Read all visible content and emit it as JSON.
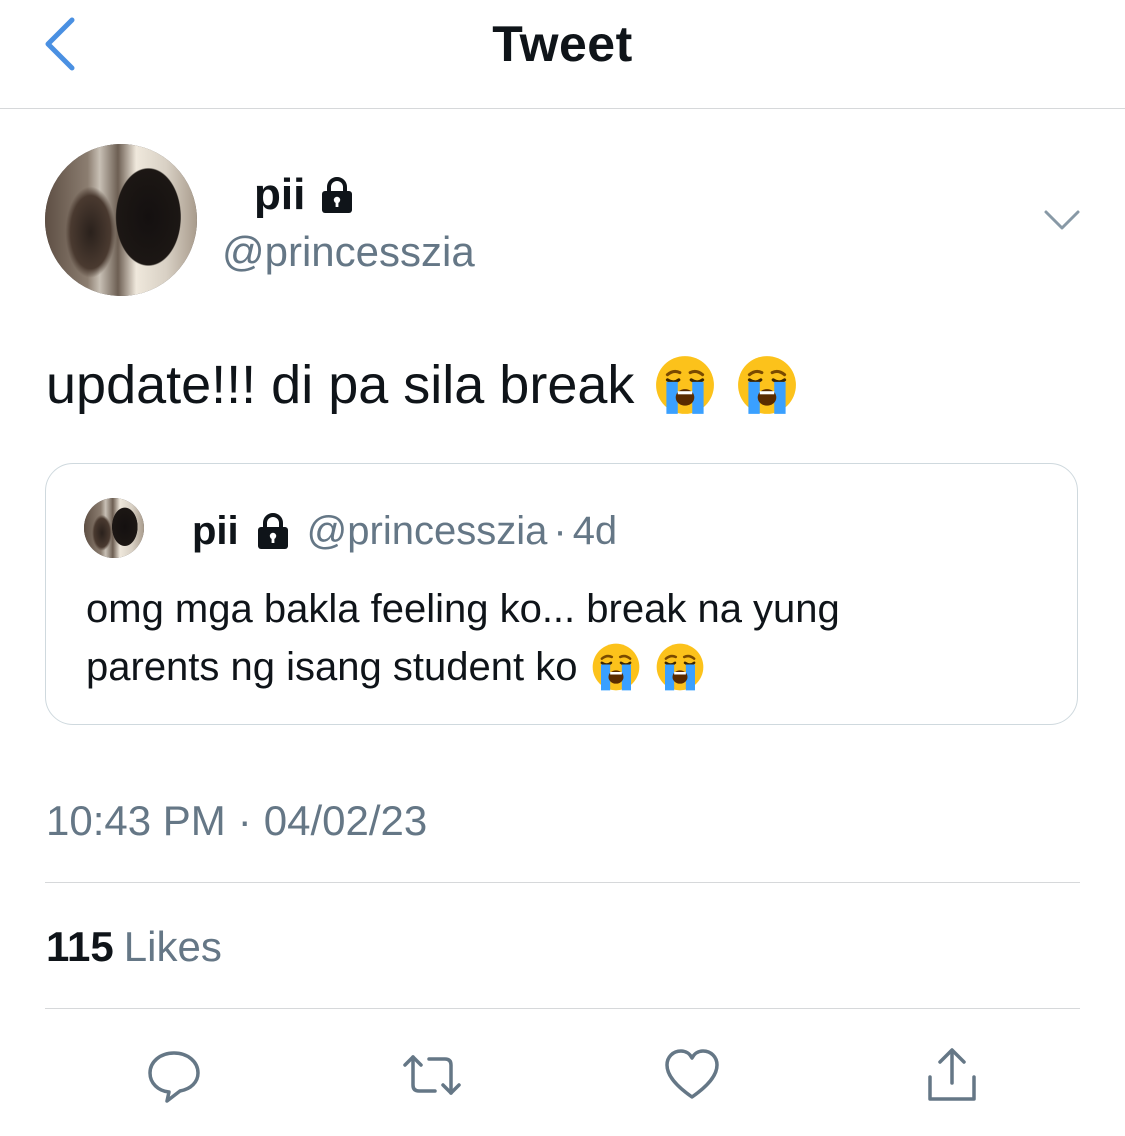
{
  "navbar": {
    "title": "Tweet",
    "back_icon": "chevron-left-icon"
  },
  "tweet": {
    "display_name": "pii",
    "protected_icon": "lock-icon",
    "handle": "@princesszia",
    "menu_icon": "chevron-down-icon",
    "text": "update!!! di pa sila break",
    "emoji": "loudly-crying-face",
    "time": "10:43 PM",
    "date": "04/02/23",
    "likes_count": "115",
    "likes_label": "Likes"
  },
  "quote": {
    "display_name": "pii",
    "handle": "@princesszia",
    "separator": "·",
    "age": "4d",
    "text_line1": "omg mga bakla feeling ko... break na yung",
    "text_line2": "parents ng isang student ko"
  },
  "actions": {
    "reply_icon": "reply-icon",
    "retweet_icon": "retweet-icon",
    "like_icon": "heart-icon",
    "share_icon": "share-icon"
  },
  "colors": {
    "accent": "#4a90e2",
    "text": "#0f1419",
    "secondary": "#657786",
    "border": "#cfd9de"
  }
}
